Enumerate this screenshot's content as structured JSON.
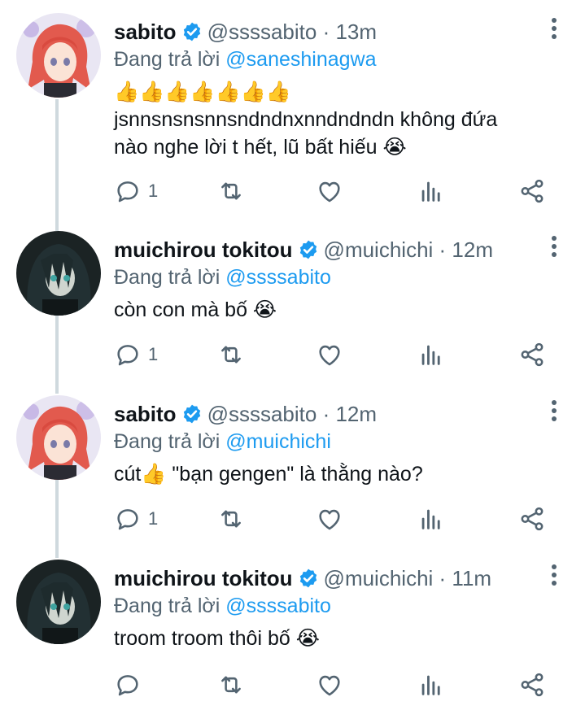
{
  "tweets": [
    {
      "name": "sabito",
      "handle": "@ssssabito",
      "time": "13m",
      "reply_prefix": "Đang trả lời",
      "reply_to": "@saneshinagwa",
      "lines": [
        "👍👍👍👍👍👍👍",
        "jsnnsnsnsnnsndndnxnndndndn không đứa",
        "nào nghe lời t hết, lũ bất hiếu 😭"
      ],
      "reply_count": "1",
      "avatar": "red-haired-character"
    },
    {
      "name": "muichirou tokitou",
      "handle": "@muichichi",
      "time": "12m",
      "reply_prefix": "Đang trả lời",
      "reply_to": "@ssssabito",
      "lines": [
        "còn con mà bố 😭"
      ],
      "reply_count": "1",
      "avatar": "dark-haired-character"
    },
    {
      "name": "sabito",
      "handle": "@ssssabito",
      "time": "12m",
      "reply_prefix": "Đang trả lời",
      "reply_to": "@muichichi",
      "lines": [
        "cút👍 \"bạn gengen\" là thằng nào?"
      ],
      "reply_count": "1",
      "avatar": "red-haired-character"
    },
    {
      "name": "muichirou tokitou",
      "handle": "@muichichi",
      "time": "11m",
      "reply_prefix": "Đang trả lời",
      "reply_to": "@ssssabito",
      "lines": [
        "troom troom thôi bố 😭"
      ],
      "reply_count": "",
      "avatar": "dark-haired-character"
    }
  ],
  "colors": {
    "accent": "#1d9bf0",
    "muted": "#536471",
    "thread": "#cfd9de"
  }
}
